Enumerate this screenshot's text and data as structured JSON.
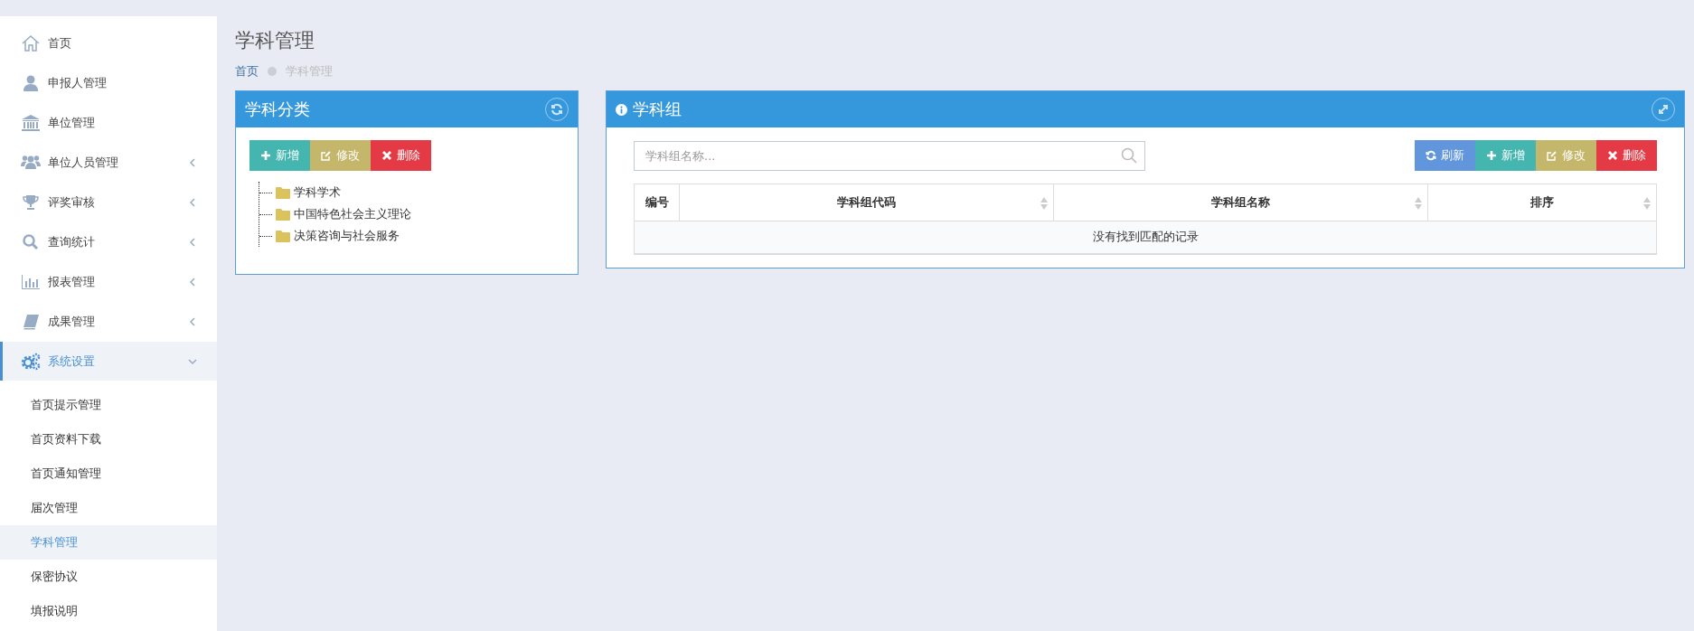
{
  "sidebar": {
    "items": [
      {
        "label": "首页",
        "kind": "home",
        "has_submenu": false,
        "selected": false
      },
      {
        "label": "申报人管理",
        "kind": "user",
        "has_submenu": false,
        "selected": false
      },
      {
        "label": "单位管理",
        "kind": "bank",
        "has_submenu": false,
        "selected": false
      },
      {
        "label": "单位人员管理",
        "kind": "users",
        "has_submenu": true,
        "expanded": false,
        "selected": false
      },
      {
        "label": "评奖审核",
        "kind": "trophy",
        "has_submenu": true,
        "expanded": false,
        "selected": false
      },
      {
        "label": "查询统计",
        "kind": "search",
        "has_submenu": true,
        "expanded": false,
        "selected": false
      },
      {
        "label": "报表管理",
        "kind": "chart",
        "has_submenu": true,
        "expanded": false,
        "selected": false
      },
      {
        "label": "成果管理",
        "kind": "book",
        "has_submenu": true,
        "expanded": false,
        "selected": false
      },
      {
        "label": "系统设置",
        "kind": "gears",
        "has_submenu": true,
        "expanded": true,
        "selected": true,
        "children": [
          {
            "label": "首页提示管理",
            "selected": false
          },
          {
            "label": "首页资料下载",
            "selected": false
          },
          {
            "label": "首页通知管理",
            "selected": false
          },
          {
            "label": "届次管理",
            "selected": false
          },
          {
            "label": "学科管理",
            "selected": true
          },
          {
            "label": "保密协议",
            "selected": false
          },
          {
            "label": "填报说明",
            "selected": false
          }
        ]
      }
    ]
  },
  "page": {
    "title": "学科管理",
    "breadcrumb": [
      "首页",
      "学科管理"
    ]
  },
  "category_panel": {
    "title": "学科分类",
    "buttons": [
      {
        "kind": "add",
        "label": "新增"
      },
      {
        "kind": "edit",
        "label": "修改"
      },
      {
        "kind": "delete",
        "label": "删除"
      }
    ],
    "tree": [
      {
        "label": "学科学术"
      },
      {
        "label": "中国特色社会主义理论"
      },
      {
        "label": "决策咨询与社会服务"
      }
    ]
  },
  "group_panel": {
    "title": "学科组",
    "search": {
      "placeholder": "学科组名称..."
    },
    "buttons": [
      {
        "kind": "refresh",
        "label": "刷新"
      },
      {
        "kind": "add",
        "label": "新增"
      },
      {
        "kind": "edit",
        "label": "修改"
      },
      {
        "kind": "delete",
        "label": "删除"
      }
    ],
    "table": {
      "columns": [
        {
          "label": "编号",
          "sortable": false
        },
        {
          "label": "学科组代码",
          "sortable": true
        },
        {
          "label": "学科组名称",
          "sortable": true
        },
        {
          "label": "排序",
          "sortable": true
        }
      ],
      "empty_message": "没有找到匹配的记录"
    }
  }
}
